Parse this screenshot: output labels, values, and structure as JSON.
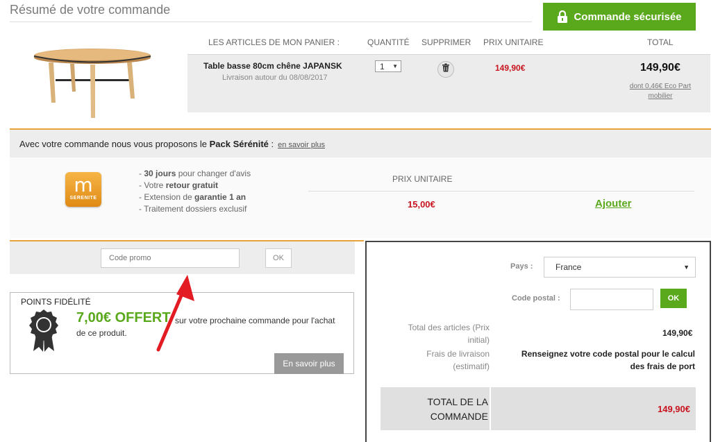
{
  "header": {
    "title": "Résumé de votre commande",
    "secure_button": "Commande sécurisée"
  },
  "cart": {
    "columns": [
      "LES ARTICLES DE MON PANIER :",
      "QUANTITÉ",
      "SUPPRIMER",
      "PRIX UNITAIRE",
      "TOTAL"
    ],
    "item": {
      "name": "Table basse 80cm chêne JAPANSK",
      "delivery": "Livraison autour du 08/08/2017",
      "quantity": "1",
      "unit_price": "149,90€",
      "total": "149,90€",
      "eco_part": "dont 0,46€ Eco Part mobilier"
    }
  },
  "pack": {
    "intro": "Avec votre commande nous vous proposons le ",
    "name": "Pack Sérénité",
    "colon": " :",
    "more_link": "en savoir plus",
    "logo_letter": "m",
    "logo_text": "SERENITE",
    "features": [
      {
        "pre": "- ",
        "bold": "30 jours",
        "post": " pour changer d'avis"
      },
      {
        "pre": "- Votre ",
        "bold": "retour gratuit",
        "post": ""
      },
      {
        "pre": "- Extension de ",
        "bold": "garantie 1 an",
        "post": ""
      },
      {
        "pre": "- Traitement dossiers exclusif",
        "bold": "",
        "post": ""
      }
    ],
    "price_header": "PRIX UNITAIRE",
    "price": "15,00€",
    "add_button": "Ajouter"
  },
  "promo": {
    "placeholder": "Code promo",
    "ok_label": "OK"
  },
  "loyalty": {
    "title": "POINTS FIDÉLITÉ",
    "offer": "7,00€ OFFERT",
    "desc_line1": "sur votre prochaine commande pour l'achat",
    "desc_line2": "de ce produit.",
    "more_button": "En savoir plus"
  },
  "summary": {
    "country_label": "Pays :",
    "country_value": "France",
    "postal_label": "Code postal :",
    "postal_ok": "OK",
    "items_total_label_1": "Total des articles (Prix",
    "items_total_label_2": "initial)",
    "items_total_value": "149,90€",
    "shipping_label_1": "Frais de livraison",
    "shipping_label_2": "(estimatif)",
    "shipping_value_1": "Renseignez votre code postal pour le calcul",
    "shipping_value_2": "des frais de port",
    "grand_total_label_1": "TOTAL DE LA",
    "grand_total_label_2": "COMMANDE",
    "grand_total_value": "149,90€"
  },
  "colors": {
    "accent_green": "#5aa81b",
    "price_red": "#c8141e",
    "separator_orange": "#e8a33c"
  },
  "icons": [
    "lock-icon",
    "trash-icon",
    "medal-icon",
    "chevron-down-icon",
    "red-arrow-annotation"
  ]
}
